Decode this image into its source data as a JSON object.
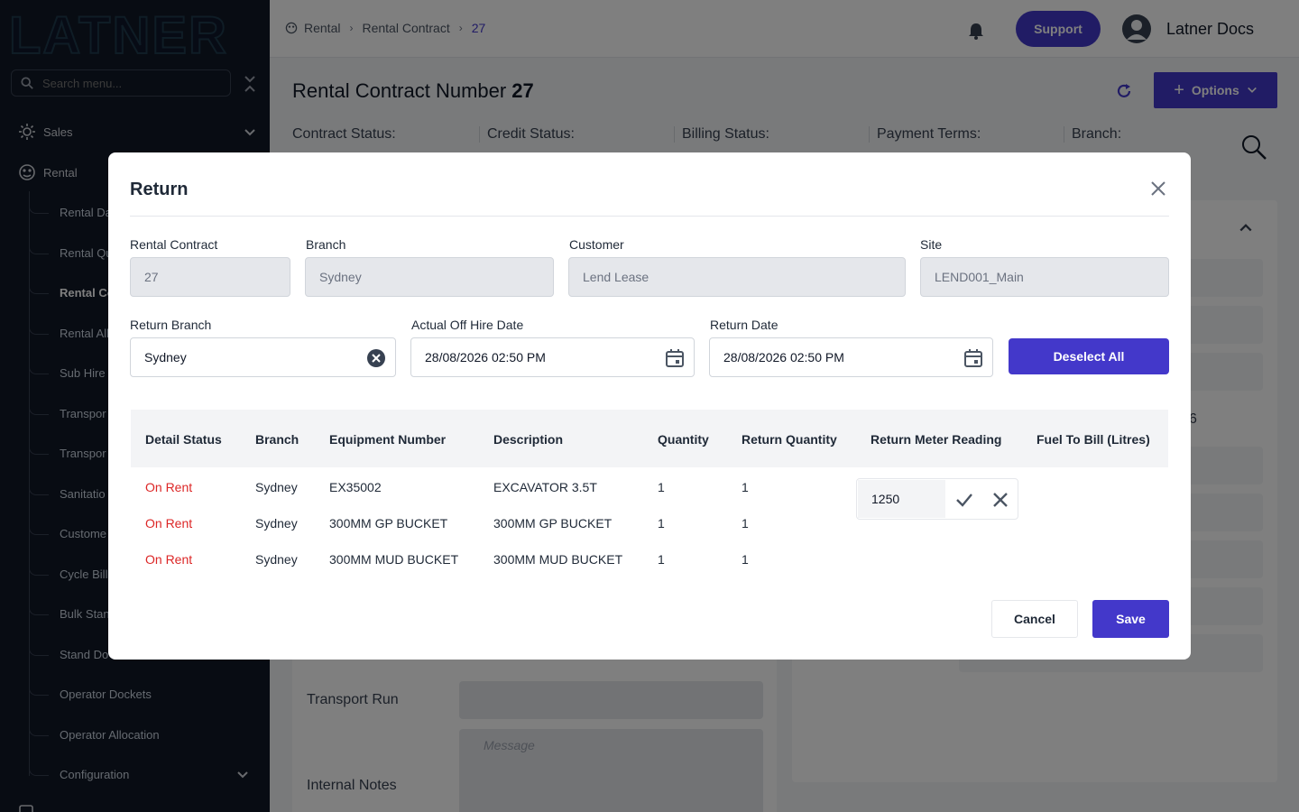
{
  "sidebar": {
    "logo_text": "LATNER",
    "search_placeholder": "Search menu...",
    "sections": [
      {
        "label": "Sales"
      },
      {
        "label": "Rental"
      }
    ],
    "sub_items": [
      {
        "label": "Rental Da"
      },
      {
        "label": "Rental Qu"
      },
      {
        "label": "Rental Co"
      },
      {
        "label": "Rental All"
      },
      {
        "label": "Sub Hire"
      },
      {
        "label": "Transpor"
      },
      {
        "label": "Transpor"
      },
      {
        "label": "Sanitatio"
      },
      {
        "label": "Custome"
      },
      {
        "label": "Cycle Bill"
      },
      {
        "label": "Bulk Stan"
      },
      {
        "label": "Stand Do"
      },
      {
        "label": "Operator Dockets"
      },
      {
        "label": "Operator Allocation"
      },
      {
        "label": "Configuration"
      }
    ]
  },
  "header": {
    "breadcrumbs": [
      "Rental",
      "Rental Contract",
      "27"
    ],
    "support_label": "Support",
    "user_name": "Latner Docs"
  },
  "page": {
    "title": "Rental Contract Number",
    "contract_number": "27",
    "options_label": "Options",
    "status_labels": [
      "Contract Status:",
      "Credit Status:",
      "Billing Status:",
      "Payment Terms:",
      "Branch:"
    ],
    "bg_labels": {
      "transport_run": "Transport Run",
      "internal_notes": "Internal Notes"
    },
    "message_placeholder": "Message",
    "side_value": "6"
  },
  "modal": {
    "title": "Return",
    "fields": {
      "rental_contract": {
        "label": "Rental Contract",
        "value": "27"
      },
      "branch": {
        "label": "Branch",
        "value": "Sydney"
      },
      "customer": {
        "label": "Customer",
        "value": "Lend Lease"
      },
      "site": {
        "label": "Site",
        "value": "LEND001_Main"
      },
      "return_branch": {
        "label": "Return Branch",
        "value": "Sydney"
      },
      "actual_off_hire_date": {
        "label": "Actual Off Hire Date",
        "value": "28/08/2026 02:50 PM"
      },
      "return_date": {
        "label": "Return Date",
        "value": "28/08/2026 02:50 PM"
      }
    },
    "deselect_label": "Deselect All",
    "table": {
      "columns": [
        "Detail Status",
        "Branch",
        "Equipment Number",
        "Description",
        "Quantity",
        "Return Quantity",
        "Return Meter Reading",
        "Fuel To Bill (Litres)"
      ],
      "rows": [
        {
          "status": "On Rent",
          "branch": "Sydney",
          "equipment": "EX35002",
          "description": "EXCAVATOR 3.5T",
          "quantity": "1",
          "return_quantity": "1",
          "meter": "1250"
        },
        {
          "status": "On Rent",
          "branch": "Sydney",
          "equipment": "300MM GP BUCKET",
          "description": "300MM GP BUCKET",
          "quantity": "1",
          "return_quantity": "1"
        },
        {
          "status": "On Rent",
          "branch": "Sydney",
          "equipment": "300MM MUD BUCKET",
          "description": "300MM MUD BUCKET",
          "quantity": "1",
          "return_quantity": "1"
        }
      ]
    },
    "cancel_label": "Cancel",
    "save_label": "Save"
  },
  "colors": {
    "accent": "#4338ca",
    "status_on_rent": "#dc2626",
    "sidebar_bg": "#111827"
  }
}
